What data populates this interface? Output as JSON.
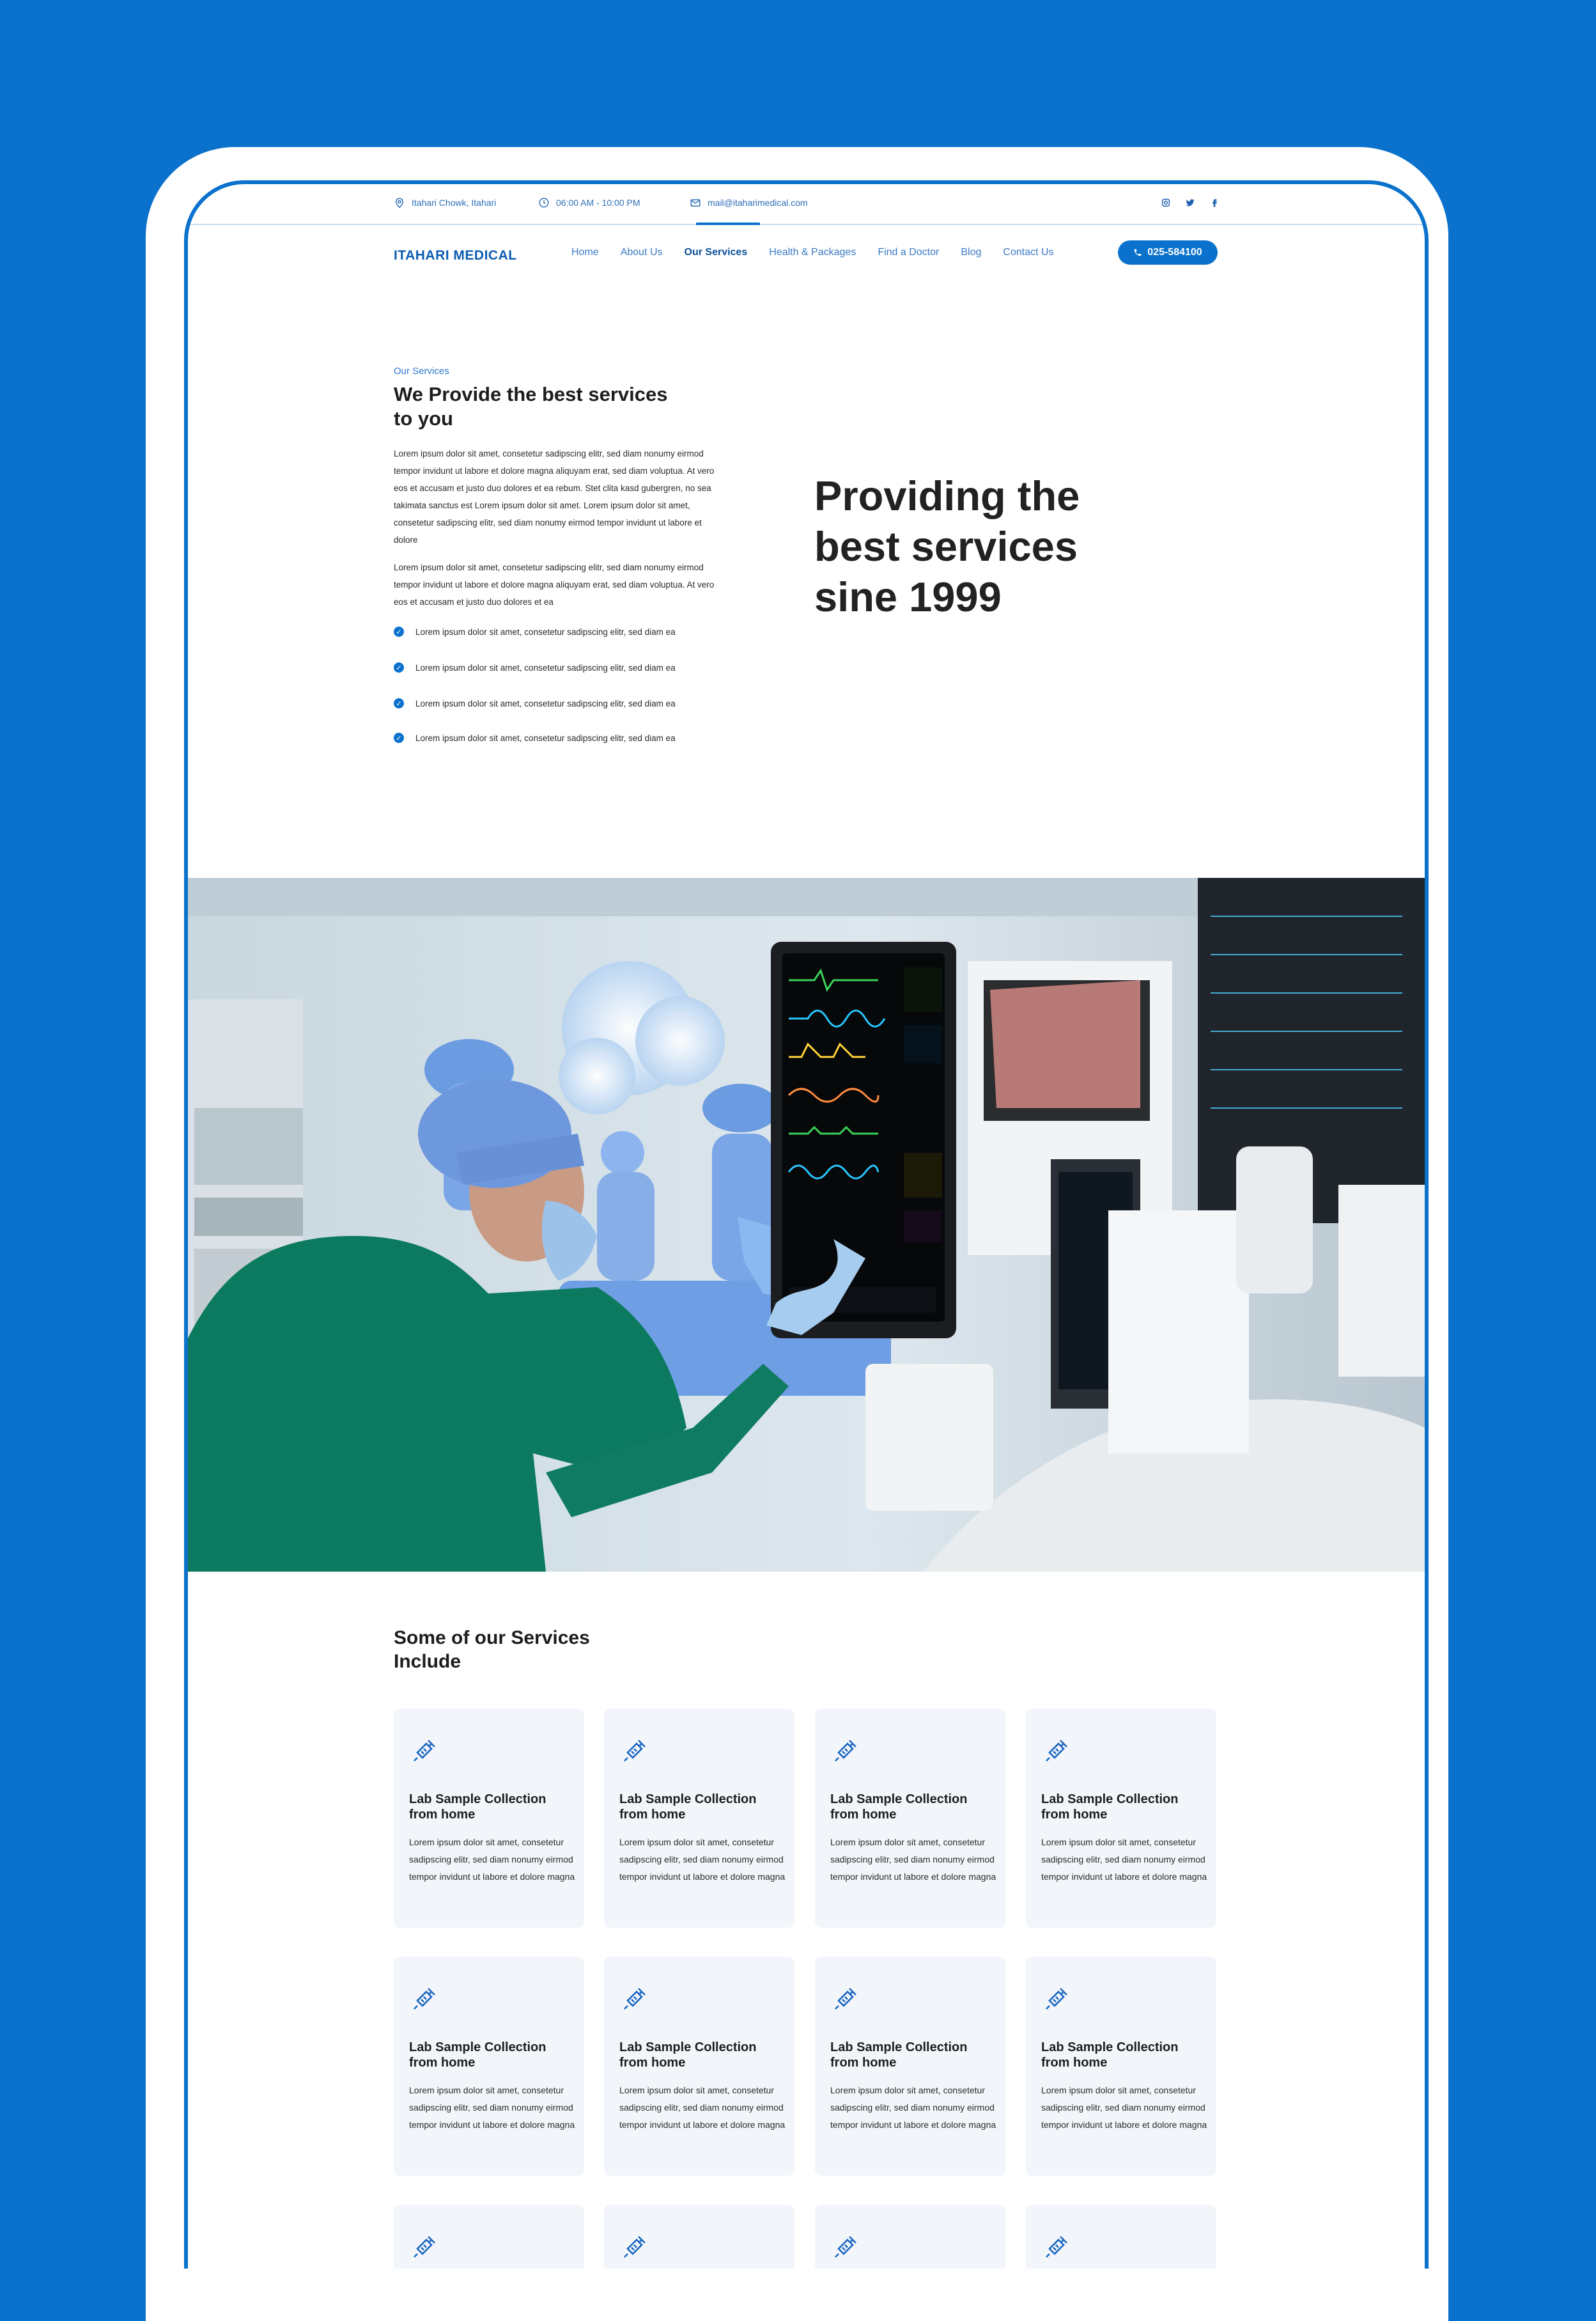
{
  "topbar": {
    "address": "Itahari Chowk, Itahari",
    "hours": "06:00 AM - 10:00 PM",
    "email": "mail@itaharimedical.com",
    "socials": [
      "instagram-icon",
      "twitter-icon",
      "facebook-icon"
    ]
  },
  "nav": {
    "logo": "ITAHARI MEDICAL",
    "items": [
      "Home",
      "About Us",
      "Our Services",
      "Health & Packages",
      "Find a Doctor",
      "Blog",
      "Contact Us"
    ],
    "active": "Our Services",
    "phone": "025-584100"
  },
  "intro": {
    "eyebrow": "Our Services",
    "title": "We Provide the best services to you",
    "para1": "Lorem ipsum dolor sit amet, consetetur sadipscing elitr, sed diam nonumy eirmod tempor invidunt ut labore et dolore magna aliquyam erat, sed diam voluptua. At vero eos et accusam et justo duo dolores et ea rebum. Stet clita kasd gubergren, no sea takimata sanctus est Lorem ipsum dolor sit amet. Lorem ipsum dolor sit amet, consetetur sadipscing elitr, sed diam nonumy eirmod tempor invidunt ut labore et dolore",
    "para2": "Lorem ipsum dolor sit amet, consetetur sadipscing elitr, sed diam nonumy eirmod tempor invidunt ut labore et dolore magna aliquyam erat, sed diam voluptua. At vero eos et accusam et justo duo dolores et ea",
    "checks": [
      "Lorem ipsum dolor sit amet, consetetur sadipscing elitr, sed diam  ea",
      "Lorem ipsum dolor sit amet, consetetur sadipscing elitr, sed diam  ea",
      "Lorem ipsum dolor sit amet, consetetur sadipscing elitr, sed diam  ea",
      "Lorem ipsum dolor sit amet, consetetur sadipscing elitr, sed diam  ea"
    ],
    "quote": "Providing the best services sine 1999"
  },
  "services": {
    "title": "Some of our Services Include",
    "cards": [
      {
        "title": "Lab Sample Collection from home",
        "desc": "Lorem ipsum dolor sit amet, consetetur sadipscing elitr, sed diam nonumy eirmod tempor invidunt ut labore et dolore magna"
      },
      {
        "title": "Lab Sample Collection from home",
        "desc": "Lorem ipsum dolor sit amet, consetetur sadipscing elitr, sed diam nonumy eirmod tempor invidunt ut labore et dolore magna"
      },
      {
        "title": "Lab Sample Collection from home",
        "desc": "Lorem ipsum dolor sit amet, consetetur sadipscing elitr, sed diam nonumy eirmod tempor invidunt ut labore et dolore magna"
      },
      {
        "title": "Lab Sample Collection from home",
        "desc": "Lorem ipsum dolor sit amet, consetetur sadipscing elitr, sed diam nonumy eirmod tempor invidunt ut labore et dolore magna"
      },
      {
        "title": "Lab Sample Collection from home",
        "desc": "Lorem ipsum dolor sit amet, consetetur sadipscing elitr, sed diam nonumy eirmod tempor invidunt ut labore et dolore magna"
      },
      {
        "title": "Lab Sample Collection from home",
        "desc": "Lorem ipsum dolor sit amet, consetetur sadipscing elitr, sed diam nonumy eirmod tempor invidunt ut labore et dolore magna"
      },
      {
        "title": "Lab Sample Collection from home",
        "desc": "Lorem ipsum dolor sit amet, consetetur sadipscing elitr, sed diam nonumy eirmod tempor invidunt ut labore et dolore magna"
      },
      {
        "title": "Lab Sample Collection from home",
        "desc": "Lorem ipsum dolor sit amet, consetetur sadipscing elitr, sed diam nonumy eirmod tempor invidunt ut labore et dolore magna"
      }
    ]
  },
  "colors": {
    "brand": "#0a72cc",
    "text": "#1d1d1d",
    "card_bg": "#f2f6fb"
  }
}
